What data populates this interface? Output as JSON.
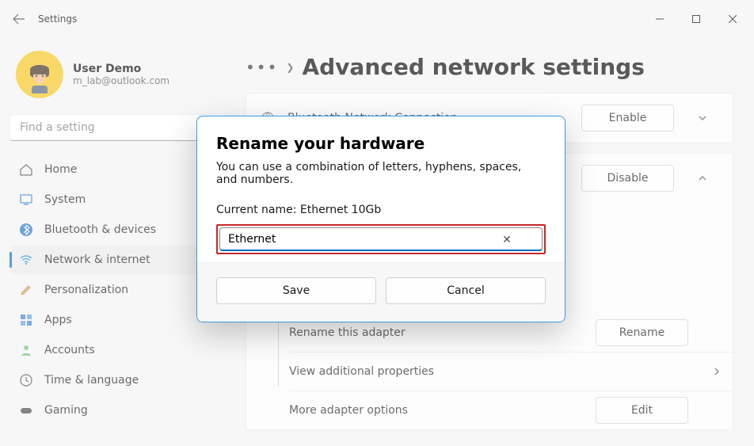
{
  "window": {
    "title": "Settings"
  },
  "profile": {
    "name": "User Demo",
    "email": "m_lab@outlook.com"
  },
  "search": {
    "placeholder": "Find a setting"
  },
  "nav": [
    {
      "label": "Home"
    },
    {
      "label": "System"
    },
    {
      "label": "Bluetooth & devices"
    },
    {
      "label": "Network & internet"
    },
    {
      "label": "Personalization"
    },
    {
      "label": "Apps"
    },
    {
      "label": "Accounts"
    },
    {
      "label": "Time & language"
    },
    {
      "label": "Gaming"
    }
  ],
  "page": {
    "title": "Advanced network settings"
  },
  "adapters": {
    "bluetooth": {
      "label": "Bluetooth Network Connection",
      "button": "Enable"
    },
    "ethernet": {
      "button": "Disable"
    }
  },
  "sub": {
    "rename": {
      "label": "Rename this adapter",
      "button": "Rename"
    },
    "view": {
      "label": "View additional properties"
    },
    "more": {
      "label": "More adapter options",
      "button": "Edit"
    }
  },
  "dialog": {
    "title": "Rename your hardware",
    "desc": "You can use a combination of letters, hyphens, spaces, and numbers.",
    "current_label": "Current name: Ethernet 10Gb",
    "input_value": "Ethernet",
    "save": "Save",
    "cancel": "Cancel"
  }
}
